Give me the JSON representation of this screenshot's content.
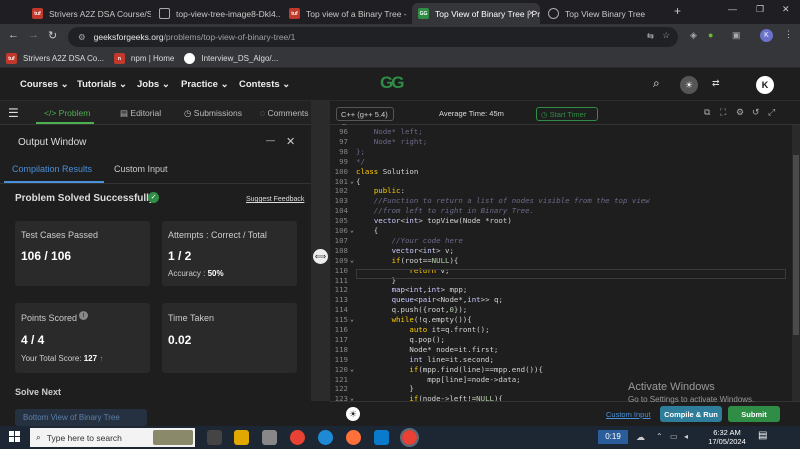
{
  "browser": {
    "tabs": [
      {
        "label": "Strivers A2Z DSA Course/She"
      },
      {
        "label": "top-view-tree-image8-Dkl4..."
      },
      {
        "label": "Top view of a Binary Tree - T"
      },
      {
        "label": "Top View of Binary Tree | Pra",
        "active": true
      },
      {
        "label": "Top View Binary Tree"
      }
    ],
    "url_domain": "geeksforgeeks.org",
    "url_path": "/problems/top-view-of-binary-tree/1",
    "profile_initial": "K",
    "bookmarks": [
      "Strivers A2Z DSA Co...",
      "npm | Home",
      "Interview_DS_Algo/..."
    ]
  },
  "gfg": {
    "logo": "GG",
    "menus": [
      "Courses",
      "Tutorials",
      "Jobs",
      "Practice",
      "Contests"
    ],
    "avatar": "K"
  },
  "problem_tabs": [
    "Problem",
    "Editorial",
    "Submissions",
    "Comments"
  ],
  "output": {
    "title": "Output Window",
    "tabs": [
      "Compilation Results",
      "Custom Input"
    ],
    "status": "Problem Solved Successfully",
    "suggest": "Suggest Feedback",
    "tests_label": "Test Cases Passed",
    "tests_value": "106 / 106",
    "attempts_label": "Attempts : Correct / Total",
    "attempts_value": "1 / 2",
    "accuracy_label": "Accuracy :",
    "accuracy_value": "50%",
    "points_label": "Points Scored",
    "points_value": "4 / 4",
    "total_label": "Your Total Score:",
    "total_value": "127",
    "time_label": "Time Taken",
    "time_value": "0.02",
    "solve_next": "Solve Next",
    "next_item": "Bottom View of Binary Tree"
  },
  "editor": {
    "language": "C++ (g++ 5.4)",
    "avg_time": "Average Time: 45m",
    "timer": "Start Timer",
    "lines": [
      {
        "n": "96",
        "text": "    Node* left;"
      },
      {
        "n": "97",
        "text": "    Node* right;"
      },
      {
        "n": "98",
        "text": "};"
      },
      {
        "n": "99",
        "text": "*/"
      },
      {
        "n": "100",
        "text": "class Solution"
      },
      {
        "n": "101",
        "text": "{"
      },
      {
        "n": "102",
        "text": "    public:"
      },
      {
        "n": "103",
        "text": "    //Function to return a list of nodes visible from the top view"
      },
      {
        "n": "104",
        "text": "    //from left to right in Binary Tree."
      },
      {
        "n": "105",
        "text": "    vector<int> topView(Node *root)"
      },
      {
        "n": "106",
        "text": "    {"
      },
      {
        "n": "107",
        "text": "        //Your code here"
      },
      {
        "n": "108",
        "text": "        vector<int> v;"
      },
      {
        "n": "109",
        "text": "        if(root==NULL){"
      },
      {
        "n": "110",
        "text": "            return v;"
      },
      {
        "n": "111",
        "text": "        }"
      },
      {
        "n": "112",
        "text": "        map<int,int> mpp;"
      },
      {
        "n": "113",
        "text": "        queue<pair<Node*,int>> q;"
      },
      {
        "n": "114",
        "text": "        q.push({root,0});"
      },
      {
        "n": "115",
        "text": "        while(!q.empty()){"
      },
      {
        "n": "116",
        "text": "            auto it=q.front();"
      },
      {
        "n": "117",
        "text": "            q.pop();"
      },
      {
        "n": "118",
        "text": "            Node* node=it.first;"
      },
      {
        "n": "119",
        "text": "            int line=it.second;"
      },
      {
        "n": "120",
        "text": "            if(mpp.find(line)==mpp.end()){"
      },
      {
        "n": "121",
        "text": "                mpp[line]=node->data;"
      },
      {
        "n": "122",
        "text": "            }"
      },
      {
        "n": "123",
        "text": "            if(node->left!=NULL){"
      }
    ],
    "custom_input": "Custom Input",
    "compile": "Compile & Run",
    "submit": "Submit"
  },
  "watermark": {
    "title": "Activate Windows",
    "sub": "Go to Settings to activate Windows."
  },
  "taskbar": {
    "search_placeholder": "Type here to search",
    "timer": "0:19",
    "time": "6:32 AM",
    "date": "17/05/2024"
  },
  "colors": {
    "gfg_green": "#2f8d46",
    "accent_green": "#4caf50",
    "link_blue": "#4a90d9"
  }
}
